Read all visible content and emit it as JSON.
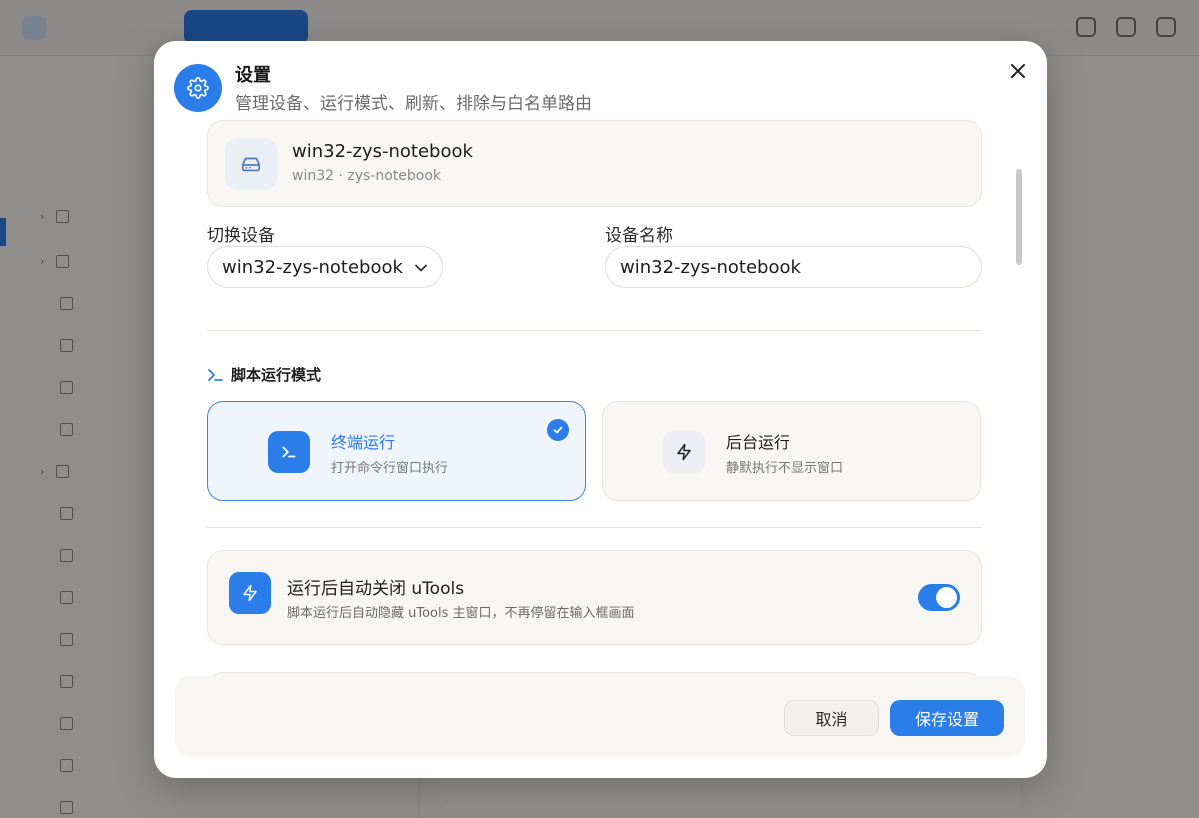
{
  "modal": {
    "title": "设置",
    "subtitle": "管理设备、运行模式、刷新、排除与白名单路由",
    "icon": "gear-icon",
    "close_icon": "close-icon"
  },
  "device": {
    "name": "win32-zys-notebook",
    "sub": "win32 · zys-notebook",
    "icon": "drive-icon"
  },
  "switch_device": {
    "label": "切换设备",
    "value": "win32-zys-notebook"
  },
  "device_name": {
    "label": "设备名称",
    "value": "win32-zys-notebook"
  },
  "run_mode": {
    "heading": "脚本运行模式",
    "options": [
      {
        "title": "终端运行",
        "desc": "打开命令行窗口执行",
        "icon": "terminal-icon",
        "selected": true
      },
      {
        "title": "后台运行",
        "desc": "静默执行不显示窗口",
        "icon": "lightning-icon",
        "selected": false
      }
    ]
  },
  "auto_close": {
    "title": "运行后自动关闭 uTools",
    "desc": "脚本运行后自动隐藏 uTools 主窗口，不再停留在输入框画面",
    "enabled": true,
    "icon": "lightning-icon"
  },
  "footer": {
    "cancel": "取消",
    "save": "保存设置"
  },
  "colors": {
    "accent": "#2b7de9",
    "overlay": "rgba(0,0,0,0.42)"
  }
}
